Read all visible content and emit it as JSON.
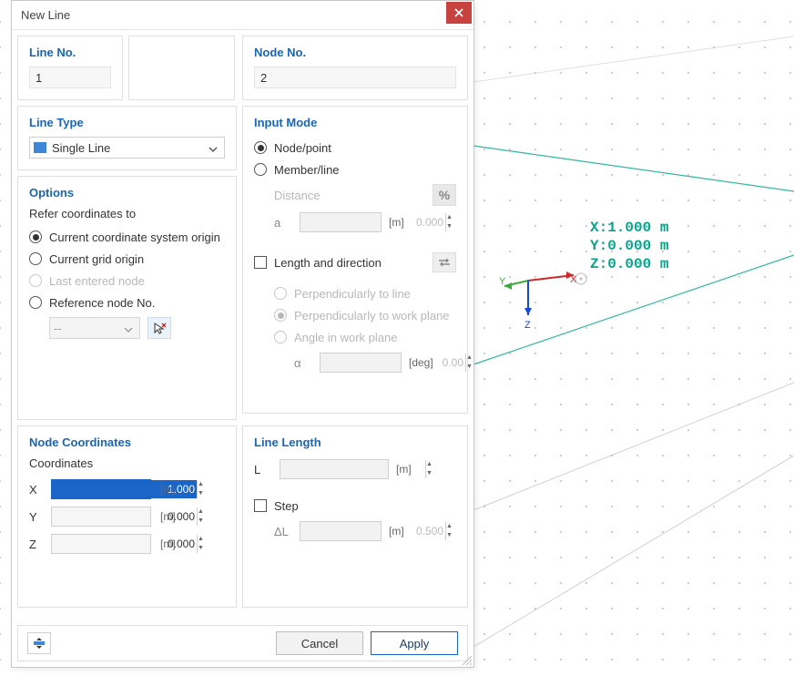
{
  "dialog": {
    "title": "New Line",
    "line_no": {
      "label": "Line No.",
      "value": "1"
    },
    "node_no": {
      "label": "Node No.",
      "value": "2"
    },
    "line_type": {
      "label": "Line Type",
      "value": "Single Line"
    },
    "options": {
      "label": "Options",
      "refer_label": "Refer coordinates to",
      "opt_cs_origin": "Current coordinate system origin",
      "opt_grid_origin": "Current grid origin",
      "opt_last_node": "Last entered node",
      "opt_ref_node": "Reference node No.",
      "ref_node_value": "--"
    },
    "input_mode": {
      "label": "Input Mode",
      "node_point": "Node/point",
      "member_line": "Member/line",
      "distance": "Distance",
      "a_label": "a",
      "a_value": "0.000",
      "a_unit": "[m]",
      "length_dir": "Length and direction",
      "perp_line": "Perpendicularly to line",
      "perp_plane": "Perpendicularly to work plane",
      "angle_plane": "Angle in work plane",
      "alpha_label": "α",
      "alpha_value": "0.00",
      "alpha_unit": "[deg]"
    },
    "coords": {
      "label": "Node Coordinates",
      "sub": "Coordinates",
      "x": "X",
      "y": "Y",
      "z": "Z",
      "x_val": "1.000",
      "y_val": "0.000",
      "z_val": "0.000",
      "unit": "[m]"
    },
    "length": {
      "label": "Line Length",
      "L": "L",
      "L_val": "",
      "L_unit": "[m]",
      "step": "Step",
      "dL": "ΔL",
      "dL_val": "0.500",
      "dL_unit": "[m]"
    },
    "buttons": {
      "cancel": "Cancel",
      "apply": "Apply"
    }
  },
  "readout": {
    "x": "X:1.000 m",
    "y": "Y:0.000 m",
    "z": "Z:0.000 m"
  },
  "axes": {
    "x": "X",
    "y": "Y",
    "z": "Z"
  }
}
